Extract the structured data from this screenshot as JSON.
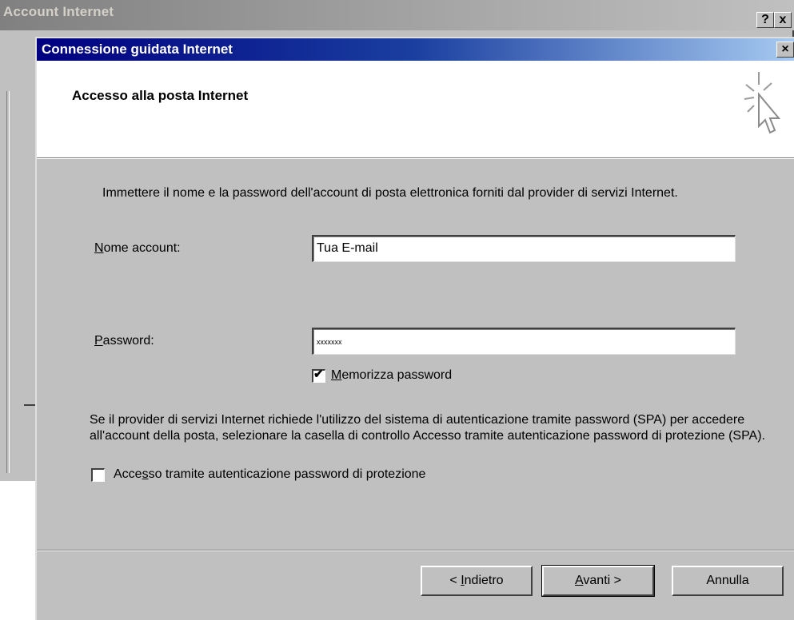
{
  "background_window": {
    "title": "Account Internet",
    "help_button": "?",
    "close_button": "x"
  },
  "dialog": {
    "title": "Connessione guidata Internet",
    "close_button": "×",
    "header_title": "Accesso alla posta Internet",
    "intro": "Immettere il nome e la password dell'account di posta elettronica forniti dal provider di servizi Internet.",
    "account": {
      "label_hotkey": "N",
      "label_rest": "ome account:",
      "value": "Tua E-mail"
    },
    "password": {
      "label_hotkey": "P",
      "label_rest": "assword:",
      "value": "xxxxxxx"
    },
    "remember": {
      "checked": true,
      "check_glyph": "✔",
      "label_hotkey": "M",
      "label_rest": "emorizza password"
    },
    "spa_info": "Se il provider di servizi Internet richiede l'utilizzo del sistema di autenticazione tramite password (SPA) per accedere all'account della posta, selezionare la casella di controllo Accesso tramite autenticazione password di protezione (SPA).",
    "spa": {
      "checked": false,
      "label_pre": "Acce",
      "label_hotkey": "s",
      "label_post": "so tramite autenticazione password di protezione"
    },
    "buttons": {
      "back_pre": "< ",
      "back_hotkey": "I",
      "back_post": "ndietro",
      "next_hotkey": "A",
      "next_post": "vanti >",
      "cancel": "Annulla"
    }
  }
}
